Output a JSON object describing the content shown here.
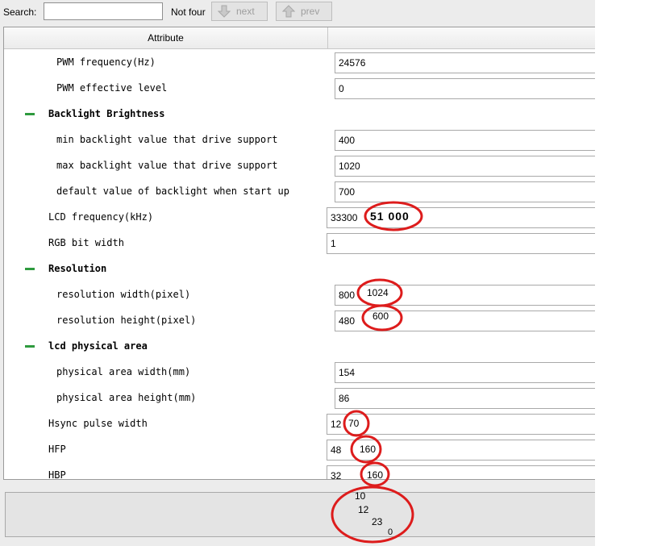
{
  "toolbar": {
    "search_label": "Search:",
    "search_value": "",
    "status_text": "Not four",
    "next_label": "next",
    "prev_label": "prev"
  },
  "grid": {
    "header_attribute": "Attribute",
    "header_value": ""
  },
  "rows": [
    {
      "name": "PWM frequency(Hz)",
      "value": "24576"
    },
    {
      "name": "PWM effective level",
      "value": "0"
    },
    {
      "group": "Backlight Brightness"
    },
    {
      "name": "min backlight value that drive support",
      "value": "400"
    },
    {
      "name": "max backlight value that drive support",
      "value": "1020"
    },
    {
      "name": "default value of backlight when start up",
      "value": "700"
    },
    {
      "name": "LCD frequency(kHz)",
      "value": "33300"
    },
    {
      "name": "RGB bit width",
      "value": "1"
    },
    {
      "group": "Resolution"
    },
    {
      "name": "resolution width(pixel)",
      "value": "800"
    },
    {
      "name": "resolution height(pixel)",
      "value": "480"
    },
    {
      "group": "lcd physical area"
    },
    {
      "name": "physical area width(mm)",
      "value": "154"
    },
    {
      "name": "physical area height(mm)",
      "value": "86"
    },
    {
      "name": "Hsync pulse width",
      "value": "12"
    },
    {
      "name": "HFP",
      "value": "48"
    },
    {
      "name": "HBP",
      "value": "32"
    }
  ],
  "annotations": {
    "lcd_freq": "51 000",
    "res_width": "1024",
    "res_height": "600",
    "hsync": "70",
    "hfp": "160",
    "hbp": "160",
    "bottom_values": [
      "10",
      "12",
      "23",
      "0"
    ],
    "circle_color": "#dd1c1c"
  },
  "colors": {
    "minus_green": "#2e9a3e"
  }
}
